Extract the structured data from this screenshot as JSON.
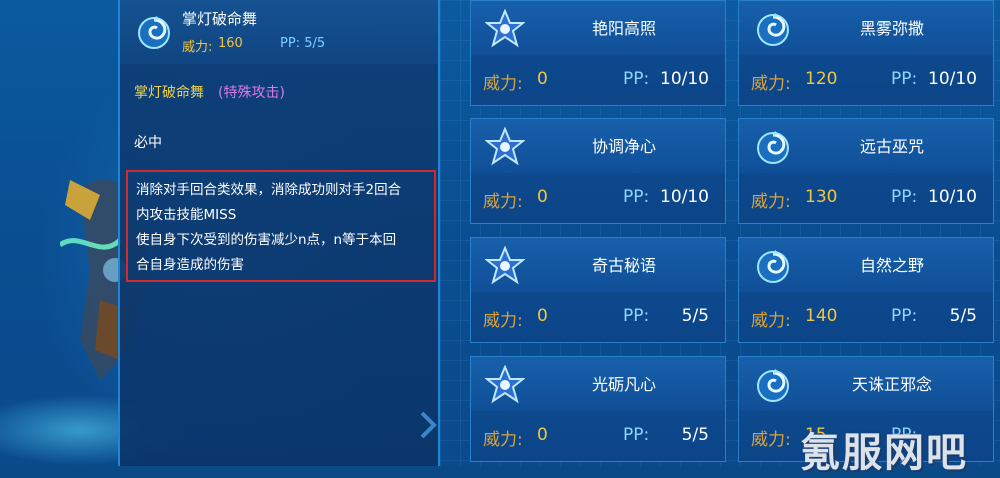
{
  "detail": {
    "title": "掌灯破命舞",
    "power_label": "威力:",
    "power_value": "160",
    "pp_text": "PP: 5/5",
    "name": "掌灯破命舞",
    "category": "(特殊攻击)",
    "hit": "必中",
    "effect_lines": [
      "消除对手回合类效果，消除成功则对手2回合",
      "内攻击技能MISS",
      "使自身下次受到的伤害减少n点，n等于本回",
      "合自身造成的伤害"
    ]
  },
  "cards": [
    {
      "icon": "star-icon",
      "name": "艳阳高照",
      "power_label": "威力:",
      "power": "0",
      "pp_label": "PP:",
      "pp": "10/10"
    },
    {
      "icon": "swirl-icon",
      "name": "黑雾弥撒",
      "power_label": "威力:",
      "power": "120",
      "pp_label": "PP:",
      "pp": "10/10"
    },
    {
      "icon": "star-icon",
      "name": "协调净心",
      "power_label": "威力:",
      "power": "0",
      "pp_label": "PP:",
      "pp": "10/10"
    },
    {
      "icon": "swirl-icon",
      "name": "远古巫咒",
      "power_label": "威力:",
      "power": "130",
      "pp_label": "PP:",
      "pp": "10/10"
    },
    {
      "icon": "star-icon",
      "name": "奇古秘语",
      "power_label": "威力:",
      "power": "0",
      "pp_label": "PP:",
      "pp": "5/5"
    },
    {
      "icon": "swirl-icon",
      "name": "自然之野",
      "power_label": "威力:",
      "power": "140",
      "pp_label": "PP:",
      "pp": "5/5"
    },
    {
      "icon": "star-icon",
      "name": "光砺凡心",
      "power_label": "威力:",
      "power": "0",
      "pp_label": "PP:",
      "pp": "5/5"
    },
    {
      "icon": "swirl-icon",
      "name": "天诛正邪念",
      "power_label": "威力:",
      "power": "15",
      "pp_label": "PP:",
      "pp": ""
    }
  ],
  "watermark": "氪服网吧",
  "colors": {
    "accent": "#1e86d6",
    "gold": "#f2c540",
    "pp": "#8fd6ff",
    "highlight_border": "#d22b2b",
    "category": "#d97be6"
  }
}
